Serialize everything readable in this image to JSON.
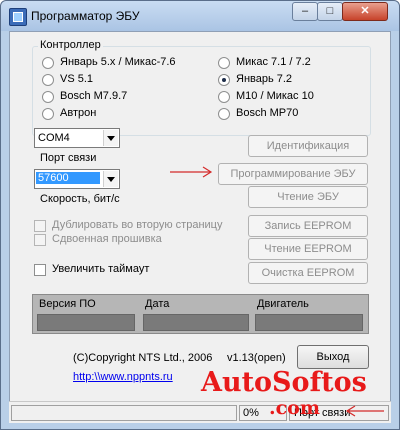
{
  "window": {
    "title": "Программатор ЭБУ",
    "minimize_glyph": "–",
    "maximize_glyph": "□",
    "close_glyph": "✕"
  },
  "controller": {
    "legend": "Контроллер",
    "options": [
      {
        "label": "Январь 5.x / Микас-7.6",
        "selected": false
      },
      {
        "label": "VS 5.1",
        "selected": false
      },
      {
        "label": "Bosch M7.9.7",
        "selected": false
      },
      {
        "label": "Автрон",
        "selected": false
      },
      {
        "label": "Микас 7.1 / 7.2",
        "selected": false
      },
      {
        "label": "Январь 7.2",
        "selected": true
      },
      {
        "label": "M10 / Микас 10",
        "selected": false
      },
      {
        "label": "Bosch MP70",
        "selected": false
      }
    ]
  },
  "port": {
    "value": "COM4",
    "label": "Порт связи"
  },
  "speed": {
    "value": "57600",
    "label": "Скорость, бит/с"
  },
  "buttons": {
    "identify": "Идентификация",
    "program": "Программирование ЭБУ",
    "read_ecu": "Чтение ЭБУ",
    "write_eeprom": "Запись EEPROM",
    "read_eeprom": "Чтение EEPROM",
    "clear_eeprom": "Очистка EEPROM",
    "exit": "Выход"
  },
  "options": {
    "duplicate": "Дублировать во вторую страницу",
    "double_firmware": "Сдвоенная прошивка",
    "increase_timeout": "Увеличить таймаут"
  },
  "info": {
    "version_label": "Версия ПО",
    "date_label": "Дата",
    "engine_label": "Двигатель"
  },
  "footer": {
    "copyright": "(C)Copyright NTS Ltd., 2006",
    "version": "v1.13(open)",
    "link": "http:\\\\www.nppnts.ru"
  },
  "status": {
    "progress": "0%",
    "port_status": "Порт связи"
  },
  "watermark": {
    "line1": "AutoSoftos",
    "line2": ".com"
  },
  "colors": {
    "annotation_arrow": "#d42a2a",
    "watermark": "#e81a1a"
  }
}
